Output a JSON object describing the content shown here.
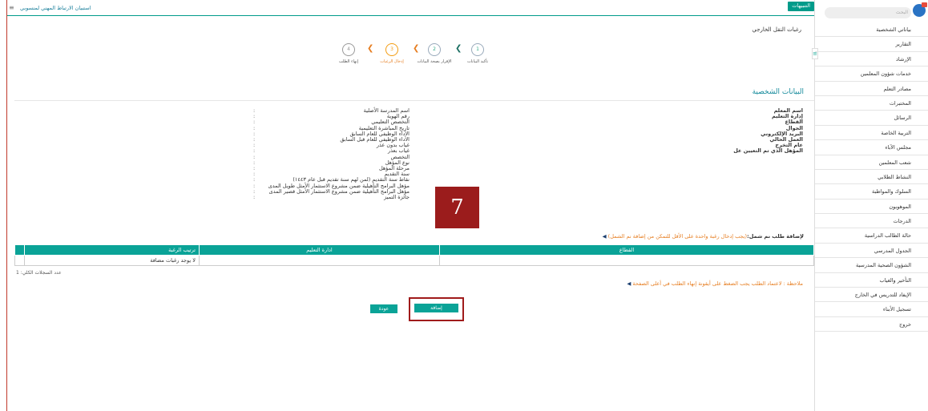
{
  "topbar": {
    "notify_label": "التنبيهات",
    "title": "استبيان الارتباط المهني لمنسوبي",
    "menu_icon": "hamburger-icon"
  },
  "page": {
    "title": "رغبات النقل الخارجي"
  },
  "steps": [
    {
      "number": "1",
      "label": "تأكيد البيانات"
    },
    {
      "number": "2",
      "label": "الإقرار بصحة البيانات"
    },
    {
      "number": "3",
      "label": "إدخال الرغبات"
    },
    {
      "number": "4",
      "label": "إنهاء الطلب"
    }
  ],
  "personal": {
    "section_title": "البيانات الشخصية",
    "right_labels": [
      "اسم المعلم",
      "إدارة التعليم",
      "القطاع",
      "الجوال",
      "البريد الإلكتروني",
      "العمل الحالي",
      "عام التخرج",
      "المؤهل الذي تم التعيين عل"
    ],
    "mid_labels": [
      "اسم المدرسة الأصلية",
      "رقم الهوية",
      "التخصص التعليمي",
      "تاريخ المباشرة التعليمية",
      "الأداء الوظيفي للعام السابق",
      "الأداء الوظيفي للعام قبل السابق",
      "غياب بدون عذر",
      "غياب بعذر",
      "التخصص",
      "نوع المؤهل",
      "مرحلة المؤهل",
      "سنة التقديم",
      "نقاط سنة التقديم (لمن لهم سنة تقديم قبل عام ١٤٤٣)",
      "مؤهل البرامج التأهيلية ضمن مشروع الاستثمار الأمثل طويل المدى",
      "مؤهل البرامج التأهيلية ضمن مشروع الاستثمار الأمثل قصير المدى",
      "جائزة التميز"
    ],
    "colons": [
      ":",
      ":",
      ":",
      ":",
      ":",
      ":",
      ":",
      ":",
      ":",
      ":",
      ":",
      ":",
      ":",
      ":",
      ":",
      ":"
    ]
  },
  "overlay_badge": "7",
  "add_request": {
    "prefix": "لإضافة طلب نم شمل:",
    "hint": "(يجب إدخال رغبة واحدة على الأقل للتمكن من إضافة نم الشمل)"
  },
  "table": {
    "headers": [
      "ترتيب الرغبة",
      "ادارة التعليم",
      "القطاع"
    ],
    "empty_text": "لا يوجد رغبات مضافة"
  },
  "records_count": "عدد السجلات الكلي: 1",
  "bottom_note": "ملاحظة : لاعتماد الطلب يجب الضغط على أيقونة إنهاء الطلب في أعلى الصفحة",
  "buttons": {
    "add": "إضافة",
    "back": "عودة"
  },
  "sidebar": {
    "search_placeholder": "البحث",
    "items": [
      "بياناتي الشخصية",
      "التقارير",
      "الإرشاد",
      "خدمات شؤون المعلمين",
      "مصادر التعلم",
      "المختبرات",
      "الرسائل",
      "التربية الخاصة",
      "مجلس الآباء",
      "شعب المعلمين",
      "النشاط الطلابي",
      "السلوك والمواظبة",
      "الموهوبون",
      "الدرجات",
      "حالة الطالب الدراسية",
      "الجدول المدرسي",
      "الشؤون الصحية المدرسية",
      "التأخير والغياب",
      "الإيفاد للتدريس في الخارج",
      "تسجيل الأبناء",
      "خروج"
    ]
  },
  "colors": {
    "accent": "#0aa397",
    "active_step": "#e67e22",
    "highlight": "#a01b1b"
  }
}
